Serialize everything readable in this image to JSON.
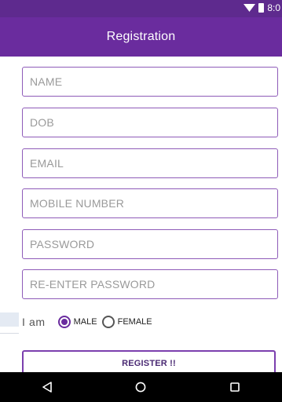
{
  "status_bar": {
    "time": "8:0"
  },
  "app_bar": {
    "title": "Registration"
  },
  "form": {
    "name_placeholder": "NAME",
    "dob_placeholder": "DOB",
    "email_placeholder": "EMAIL",
    "mobile_placeholder": "MOBILE NUMBER",
    "password_placeholder": "PASSWORD",
    "repassword_placeholder": "RE-ENTER PASSWORD",
    "name_value": "",
    "dob_value": "",
    "email_value": "",
    "mobile_value": "",
    "password_value": "",
    "repassword_value": ""
  },
  "gender": {
    "label": "I am",
    "options": [
      {
        "label": "MALE",
        "selected": true
      },
      {
        "label": "FEMALE",
        "selected": false
      }
    ]
  },
  "register_button": {
    "label": "REGISTER !!"
  },
  "colors": {
    "primary": "#6a2c9e",
    "primary_dark": "#5e2a8e",
    "field_border": "#8e5bb8",
    "nav_bar": "#000000"
  },
  "icons": {
    "status": [
      "wifi-icon",
      "battery-icon"
    ],
    "nav": [
      "back-icon",
      "home-icon",
      "recents-icon"
    ]
  }
}
